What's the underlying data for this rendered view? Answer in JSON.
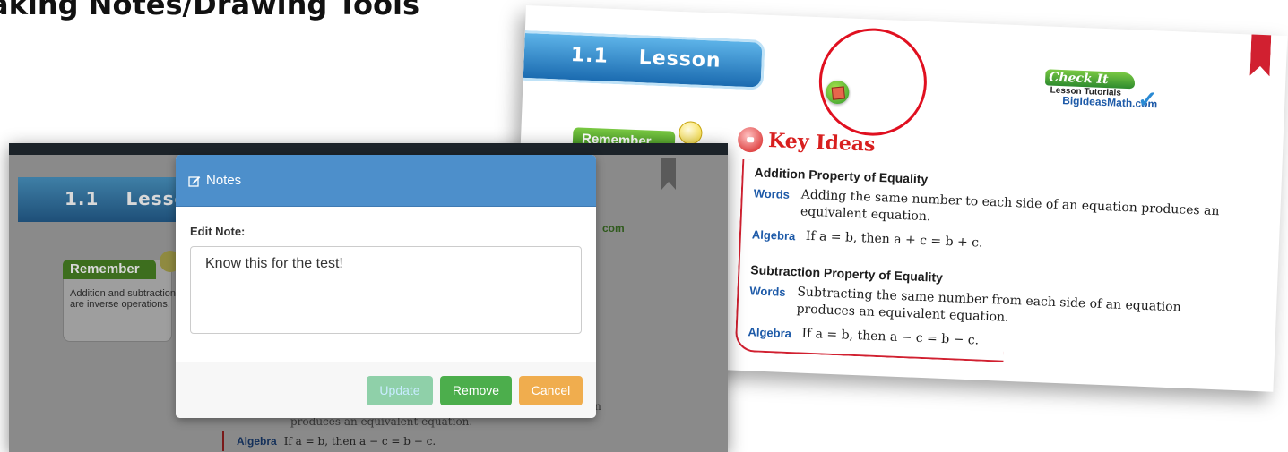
{
  "slide": {
    "title": "aking Notes/Drawing Tools"
  },
  "right_page": {
    "lesson_number": "1.1",
    "lesson_label": "Lesson",
    "check_it_out": {
      "title": "Check It Out",
      "subtitle": "Lesson Tutorials",
      "site": "BigIdeasMath.com"
    },
    "remember_label": "Remember",
    "key_ideas_title": "Key Ideas",
    "sections": [
      {
        "title": "Addition Property of Equality",
        "words_label": "Words",
        "words": "Adding the same number to each side of an equation produces an equivalent equation.",
        "algebra_label": "Algebra",
        "algebra": "If a = b, then a + c = b + c."
      },
      {
        "title": "Subtraction Property of Equality",
        "words_label": "Words",
        "words": "Subtracting the same number from each side of an equation produces an equivalent equation.",
        "algebra_label": "Algebra",
        "algebra": "If a = b, then a − c = b − c."
      }
    ],
    "colors": {
      "highlight_circle": "#e01020",
      "key_ideas": "#d81f1f",
      "label_blue": "#1d5aa8"
    }
  },
  "left_page": {
    "lesson_number": "1.1",
    "lesson_label_partial": "Lesso",
    "com_fragment": "com",
    "remember_label": "Remember",
    "remember_text": "Addition and subtraction are inverse operations.",
    "fragment_text": "produces an equivalent equation.",
    "fragment_right": "ion",
    "algebra_label": "Algebra",
    "algebra": "If a = b, then a − c = b − c."
  },
  "modal": {
    "title": "Notes",
    "edit_label": "Edit Note:",
    "note_value": "Know this for the test!",
    "buttons": {
      "update": "Update",
      "remove": "Remove",
      "cancel": "Cancel"
    },
    "colors": {
      "header": "#4d8fcb",
      "remove": "#4cae4c",
      "cancel": "#f0ad4e",
      "update": "#8fd0a9"
    }
  }
}
